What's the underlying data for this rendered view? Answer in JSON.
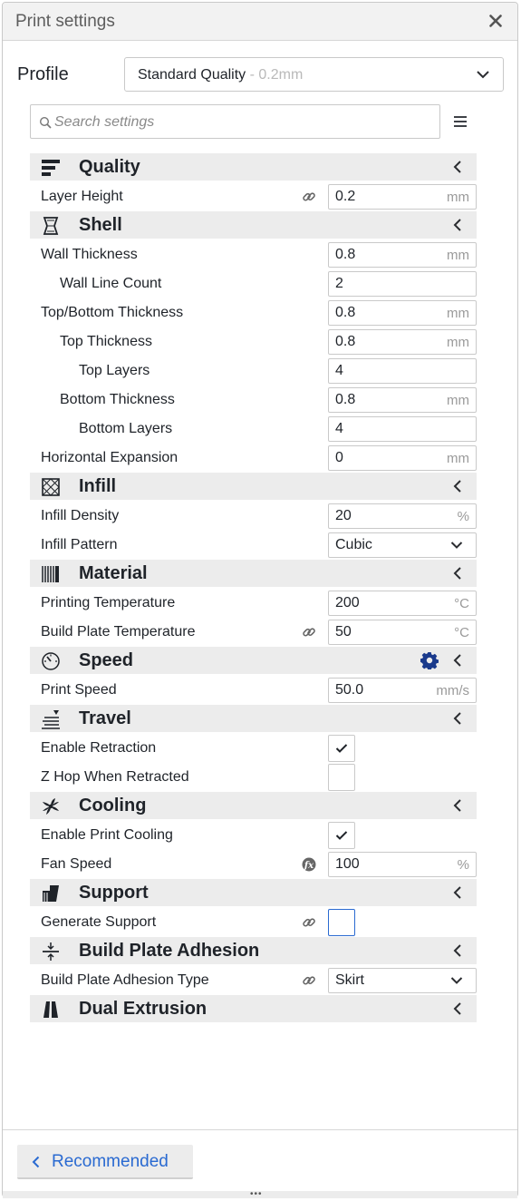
{
  "window": {
    "title": "Print settings"
  },
  "profile": {
    "label": "Profile",
    "name": "Standard Quality",
    "suffix": " - 0.2mm"
  },
  "search": {
    "placeholder": "Search settings"
  },
  "categories": [
    {
      "label": "Quality",
      "icon": "quality-icon"
    },
    {
      "label": "Shell",
      "icon": "shell-icon"
    },
    {
      "label": "Infill",
      "icon": "infill-icon"
    },
    {
      "label": "Material",
      "icon": "material-icon"
    },
    {
      "label": "Speed",
      "icon": "speed-icon"
    },
    {
      "label": "Travel",
      "icon": "travel-icon"
    },
    {
      "label": "Cooling",
      "icon": "cooling-icon"
    },
    {
      "label": "Support",
      "icon": "support-icon"
    },
    {
      "label": "Build Plate Adhesion",
      "icon": "adhesion-icon"
    },
    {
      "label": "Dual Extrusion",
      "icon": "dual-extrusion-icon"
    }
  ],
  "settings": {
    "layer_height": {
      "label": "Layer Height",
      "value": "0.2",
      "unit": "mm"
    },
    "wall_thickness": {
      "label": "Wall Thickness",
      "value": "0.8",
      "unit": "mm"
    },
    "wall_line_count": {
      "label": "Wall Line Count",
      "value": "2"
    },
    "top_bottom_thickness": {
      "label": "Top/Bottom Thickness",
      "value": "0.8",
      "unit": "mm"
    },
    "top_thickness": {
      "label": "Top Thickness",
      "value": "0.8",
      "unit": "mm"
    },
    "top_layers": {
      "label": "Top Layers",
      "value": "4"
    },
    "bottom_thickness": {
      "label": "Bottom Thickness",
      "value": "0.8",
      "unit": "mm"
    },
    "bottom_layers": {
      "label": "Bottom Layers",
      "value": "4"
    },
    "horizontal_expansion": {
      "label": "Horizontal Expansion",
      "value": "0",
      "unit": "mm"
    },
    "infill_density": {
      "label": "Infill Density",
      "value": "20",
      "unit": "%"
    },
    "infill_pattern": {
      "label": "Infill Pattern",
      "value": "Cubic"
    },
    "printing_temperature": {
      "label": "Printing Temperature",
      "value": "200",
      "unit": "°C"
    },
    "build_plate_temperature": {
      "label": "Build Plate Temperature",
      "value": "50",
      "unit": "°C"
    },
    "print_speed": {
      "label": "Print Speed",
      "value": "50.0",
      "unit": "mm/s"
    },
    "enable_retraction": {
      "label": "Enable Retraction",
      "checked": true
    },
    "z_hop": {
      "label": "Z Hop When Retracted",
      "checked": false
    },
    "enable_print_cooling": {
      "label": "Enable Print Cooling",
      "checked": true
    },
    "fan_speed": {
      "label": "Fan Speed",
      "value": "100",
      "unit": "%"
    },
    "generate_support": {
      "label": "Generate Support",
      "checked": false
    },
    "adhesion_type": {
      "label": "Build Plate Adhesion Type",
      "value": "Skirt"
    }
  },
  "footer": {
    "recommended_label": "Recommended"
  },
  "colors": {
    "accent": "#2a6ad1",
    "category_bg": "#ececec",
    "titlebar_bg": "#f2f2f2"
  }
}
